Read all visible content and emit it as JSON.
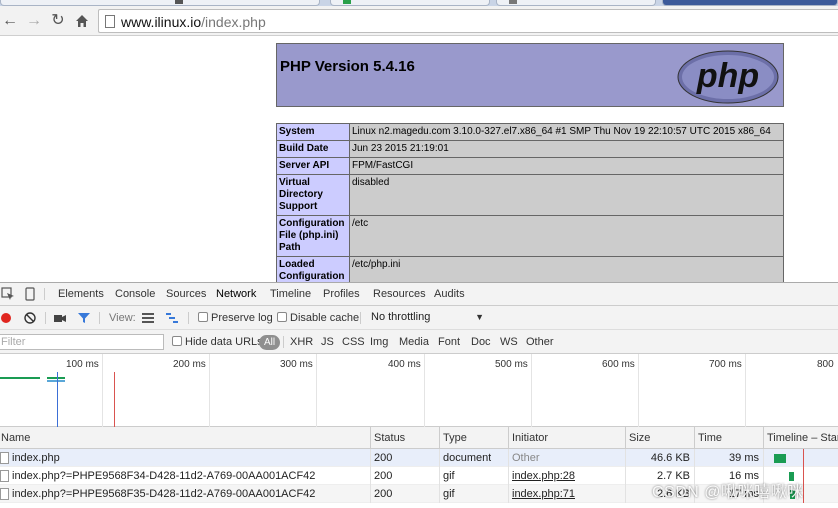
{
  "browser": {
    "url_host": "www.ilinux.io",
    "url_path": "/index.php"
  },
  "page": {
    "title": "PHP Version 5.4.16",
    "logo_text": "php",
    "info_rows": [
      {
        "key": "System",
        "value": "Linux n2.magedu.com 3.10.0-327.el7.x86_64 #1 SMP Thu Nov 19 22:10:57 UTC 2015 x86_64"
      },
      {
        "key": "Build Date",
        "value": "Jun 23 2015 21:19:01"
      },
      {
        "key": "Server API",
        "value": "FPM/FastCGI"
      },
      {
        "key": "Virtual Directory Support",
        "value": "disabled"
      },
      {
        "key": "Configuration File (php.ini) Path",
        "value": "/etc"
      },
      {
        "key": "Loaded Configuration",
        "value": "/etc/php.ini"
      }
    ]
  },
  "devtools": {
    "tabs": [
      "Elements",
      "Console",
      "Sources",
      "Network",
      "Timeline",
      "Profiles",
      "Resources",
      "Audits"
    ],
    "active_tab": "Network",
    "controls": {
      "view_label": "View:",
      "preserve_log": "Preserve log",
      "disable_cache": "Disable cache",
      "throttling": "No throttling"
    },
    "filter": {
      "placeholder": "Filter",
      "hide_data_urls": "Hide data URLs",
      "types": [
        "All",
        "XHR",
        "JS",
        "CSS",
        "Img",
        "Media",
        "Font",
        "Doc",
        "WS",
        "Other"
      ]
    },
    "overview_ticks": [
      "100 ms",
      "200 ms",
      "300 ms",
      "400 ms",
      "500 ms",
      "600 ms",
      "700 ms",
      "800"
    ],
    "columns": [
      "Name",
      "Status",
      "Type",
      "Initiator",
      "Size",
      "Time",
      "Timeline – Start"
    ],
    "requests": [
      {
        "name": "index.php",
        "status": "200",
        "type": "document",
        "initiator": "Other",
        "size": "46.6 KB",
        "time": "39 ms"
      },
      {
        "name": "index.php?=PHPE9568F34-D428-11d2-A769-00AA001ACF42",
        "status": "200",
        "type": "gif",
        "initiator": "index.php:28",
        "size": "2.7 KB",
        "time": "16 ms"
      },
      {
        "name": "index.php?=PHPE9568F35-D428-11d2-A769-00AA001ACF42",
        "status": "200",
        "type": "gif",
        "initiator": "index.php:71",
        "size": "2.6 KB",
        "time": "17 ms"
      }
    ]
  },
  "watermark": "CSDN @啾咪嘻啾咪",
  "colors": {
    "php_header": "#9999cc",
    "php_key": "#ccccff",
    "php_value": "#cccccc",
    "record_red": "#e0261f",
    "accent_blue": "#3879d9",
    "timeline_green": "#1a9c53"
  }
}
